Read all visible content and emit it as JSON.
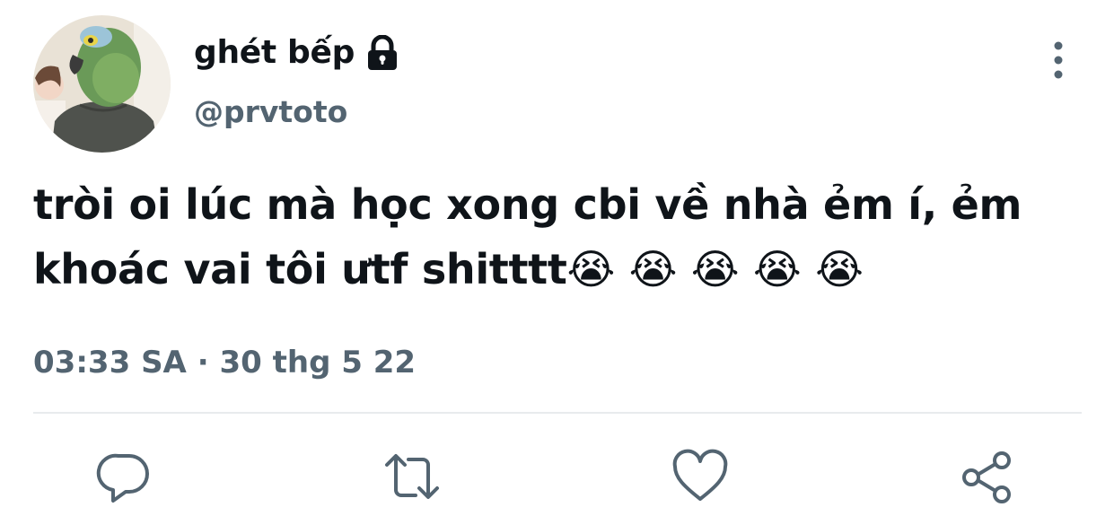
{
  "tweet": {
    "author": {
      "display_name": "ghét bếp",
      "handle": "@prvtoto",
      "protected_icon": "lock-icon",
      "avatar": "avatar"
    },
    "more_icon": "more-vertical-icon",
    "text": "tròi oi lúc mà học xong cbi về nhà ẻm í, ẻm khoác vai tôi ưtf shitttt😭 😭 😭 😭 😭",
    "time": "03:33 SA",
    "separator": " · ",
    "date": "30 thg 5 22",
    "actions": [
      {
        "name": "reply",
        "icon": "reply-icon"
      },
      {
        "name": "retweet",
        "icon": "retweet-icon"
      },
      {
        "name": "like",
        "icon": "heart-icon"
      },
      {
        "name": "share",
        "icon": "share-icon"
      }
    ]
  },
  "colors": {
    "text_primary": "#0f1419",
    "text_secondary": "#536471",
    "divider": "#e8ebed",
    "background": "#ffffff"
  }
}
